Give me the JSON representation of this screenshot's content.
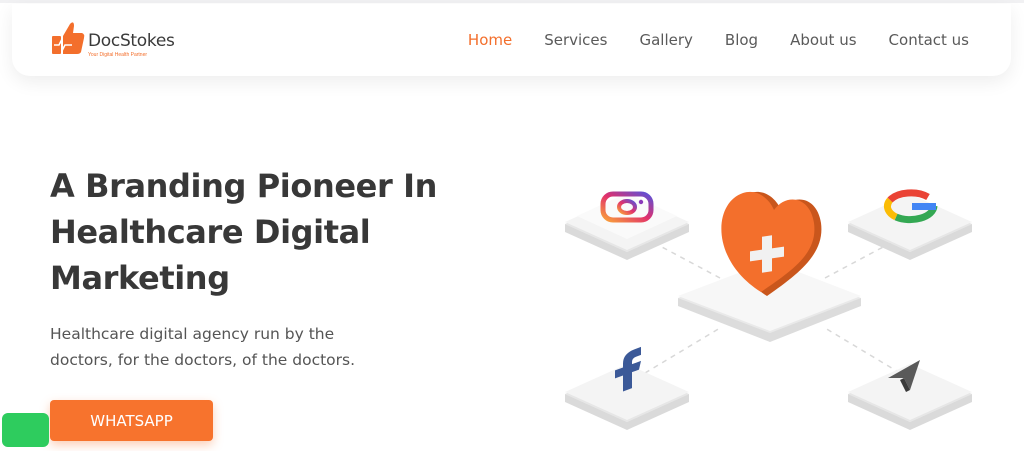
{
  "brand": {
    "name": "DocStokes",
    "tagline": "Your Digital Health Partner",
    "accent_color": "#f36f2c"
  },
  "nav": {
    "items": [
      {
        "label": "Home",
        "active": true
      },
      {
        "label": "Services",
        "active": false
      },
      {
        "label": "Gallery",
        "active": false
      },
      {
        "label": "Blog",
        "active": false
      },
      {
        "label": "About us",
        "active": false
      },
      {
        "label": "Contact us",
        "active": false
      }
    ]
  },
  "hero": {
    "title_lines": [
      "A Branding Pioneer In",
      "Healthcare Digital",
      "Marketing"
    ],
    "subtitle_lines": [
      "Healthcare digital agency run by the",
      "doctors, for the doctors, of the doctors."
    ],
    "cta_label": "WHATSAPP"
  },
  "illustration": {
    "center": "heart-cross-icon",
    "tiles": [
      "instagram-icon",
      "google-icon",
      "facebook-icon",
      "navigation-arrow-icon"
    ]
  },
  "floating_button": {
    "color": "#2ecc5e"
  }
}
